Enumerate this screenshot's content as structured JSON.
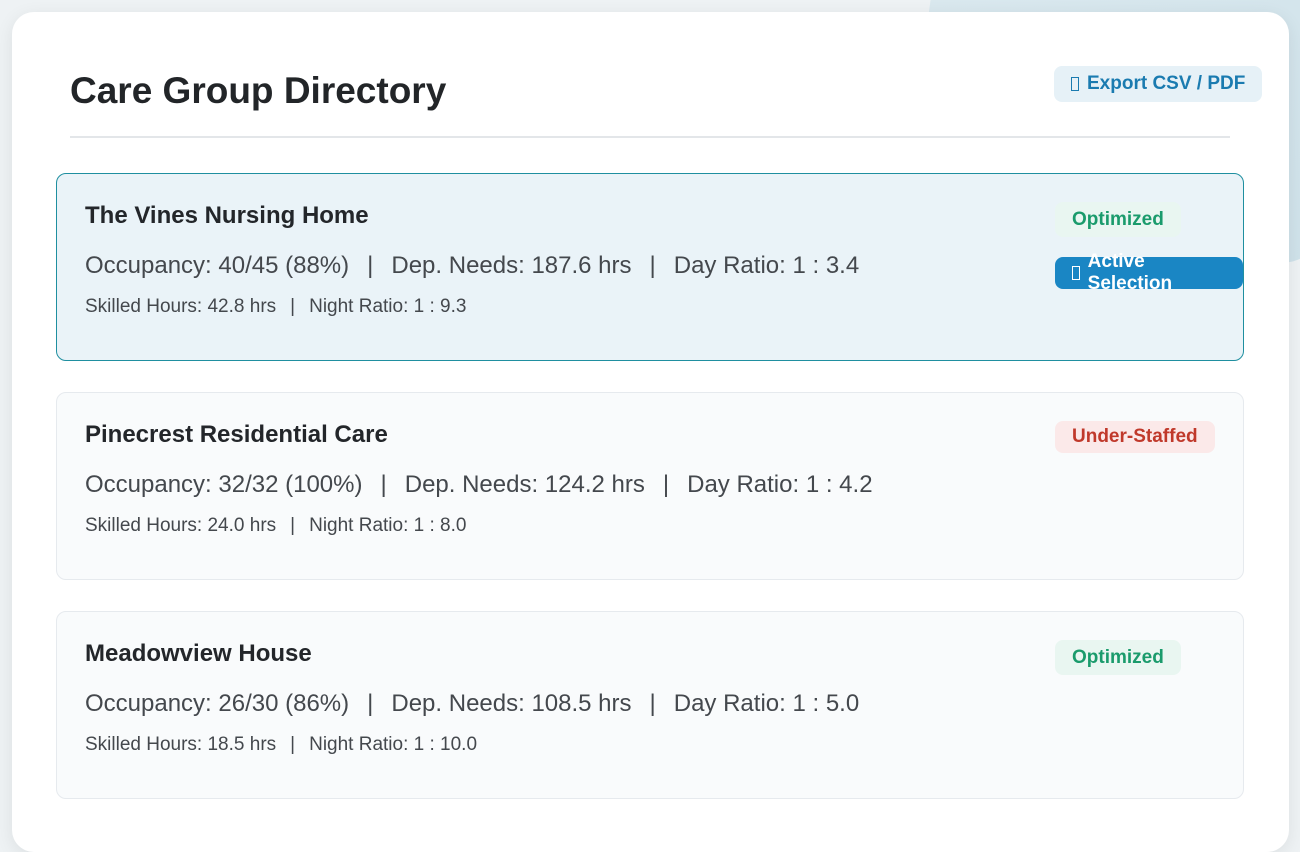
{
  "header": {
    "title": "Care Group Directory",
    "export_label": "Export CSV / PDF",
    "export_icon": "download-icon"
  },
  "colors": {
    "accent": "#1a86c4",
    "optimized": "#1a9b6c",
    "understaffed": "#c0392b"
  },
  "cards": [
    {
      "name": "The Vines Nursing Home",
      "occupancy": "Occupancy: 40/45 (88%)",
      "dep_needs": "Dep. Needs: 187.6 hrs",
      "day_ratio": "Day Ratio: 1 : 3.4",
      "skilled_hours": "Skilled Hours: 42.8 hrs",
      "night_ratio": "Night Ratio: 1 : 9.3",
      "status": "Optimized",
      "active_label": "Active Selection",
      "active_icon": "check-icon"
    },
    {
      "name": "Pinecrest Residential Care",
      "occupancy": "Occupancy: 32/32 (100%)",
      "dep_needs": "Dep. Needs: 124.2 hrs",
      "day_ratio": "Day Ratio: 1 : 4.2",
      "skilled_hours": "Skilled Hours: 24.0 hrs",
      "night_ratio": "Night Ratio: 1 : 8.0",
      "status": "Under-Staffed"
    },
    {
      "name": "Meadowview House",
      "occupancy": "Occupancy: 26/30 (86%)",
      "dep_needs": "Dep. Needs: 108.5 hrs",
      "day_ratio": "Day Ratio: 1 : 5.0",
      "skilled_hours": "Skilled Hours: 18.5 hrs",
      "night_ratio": "Night Ratio: 1 : 10.0",
      "status": "Optimized"
    }
  ],
  "separator": "|"
}
